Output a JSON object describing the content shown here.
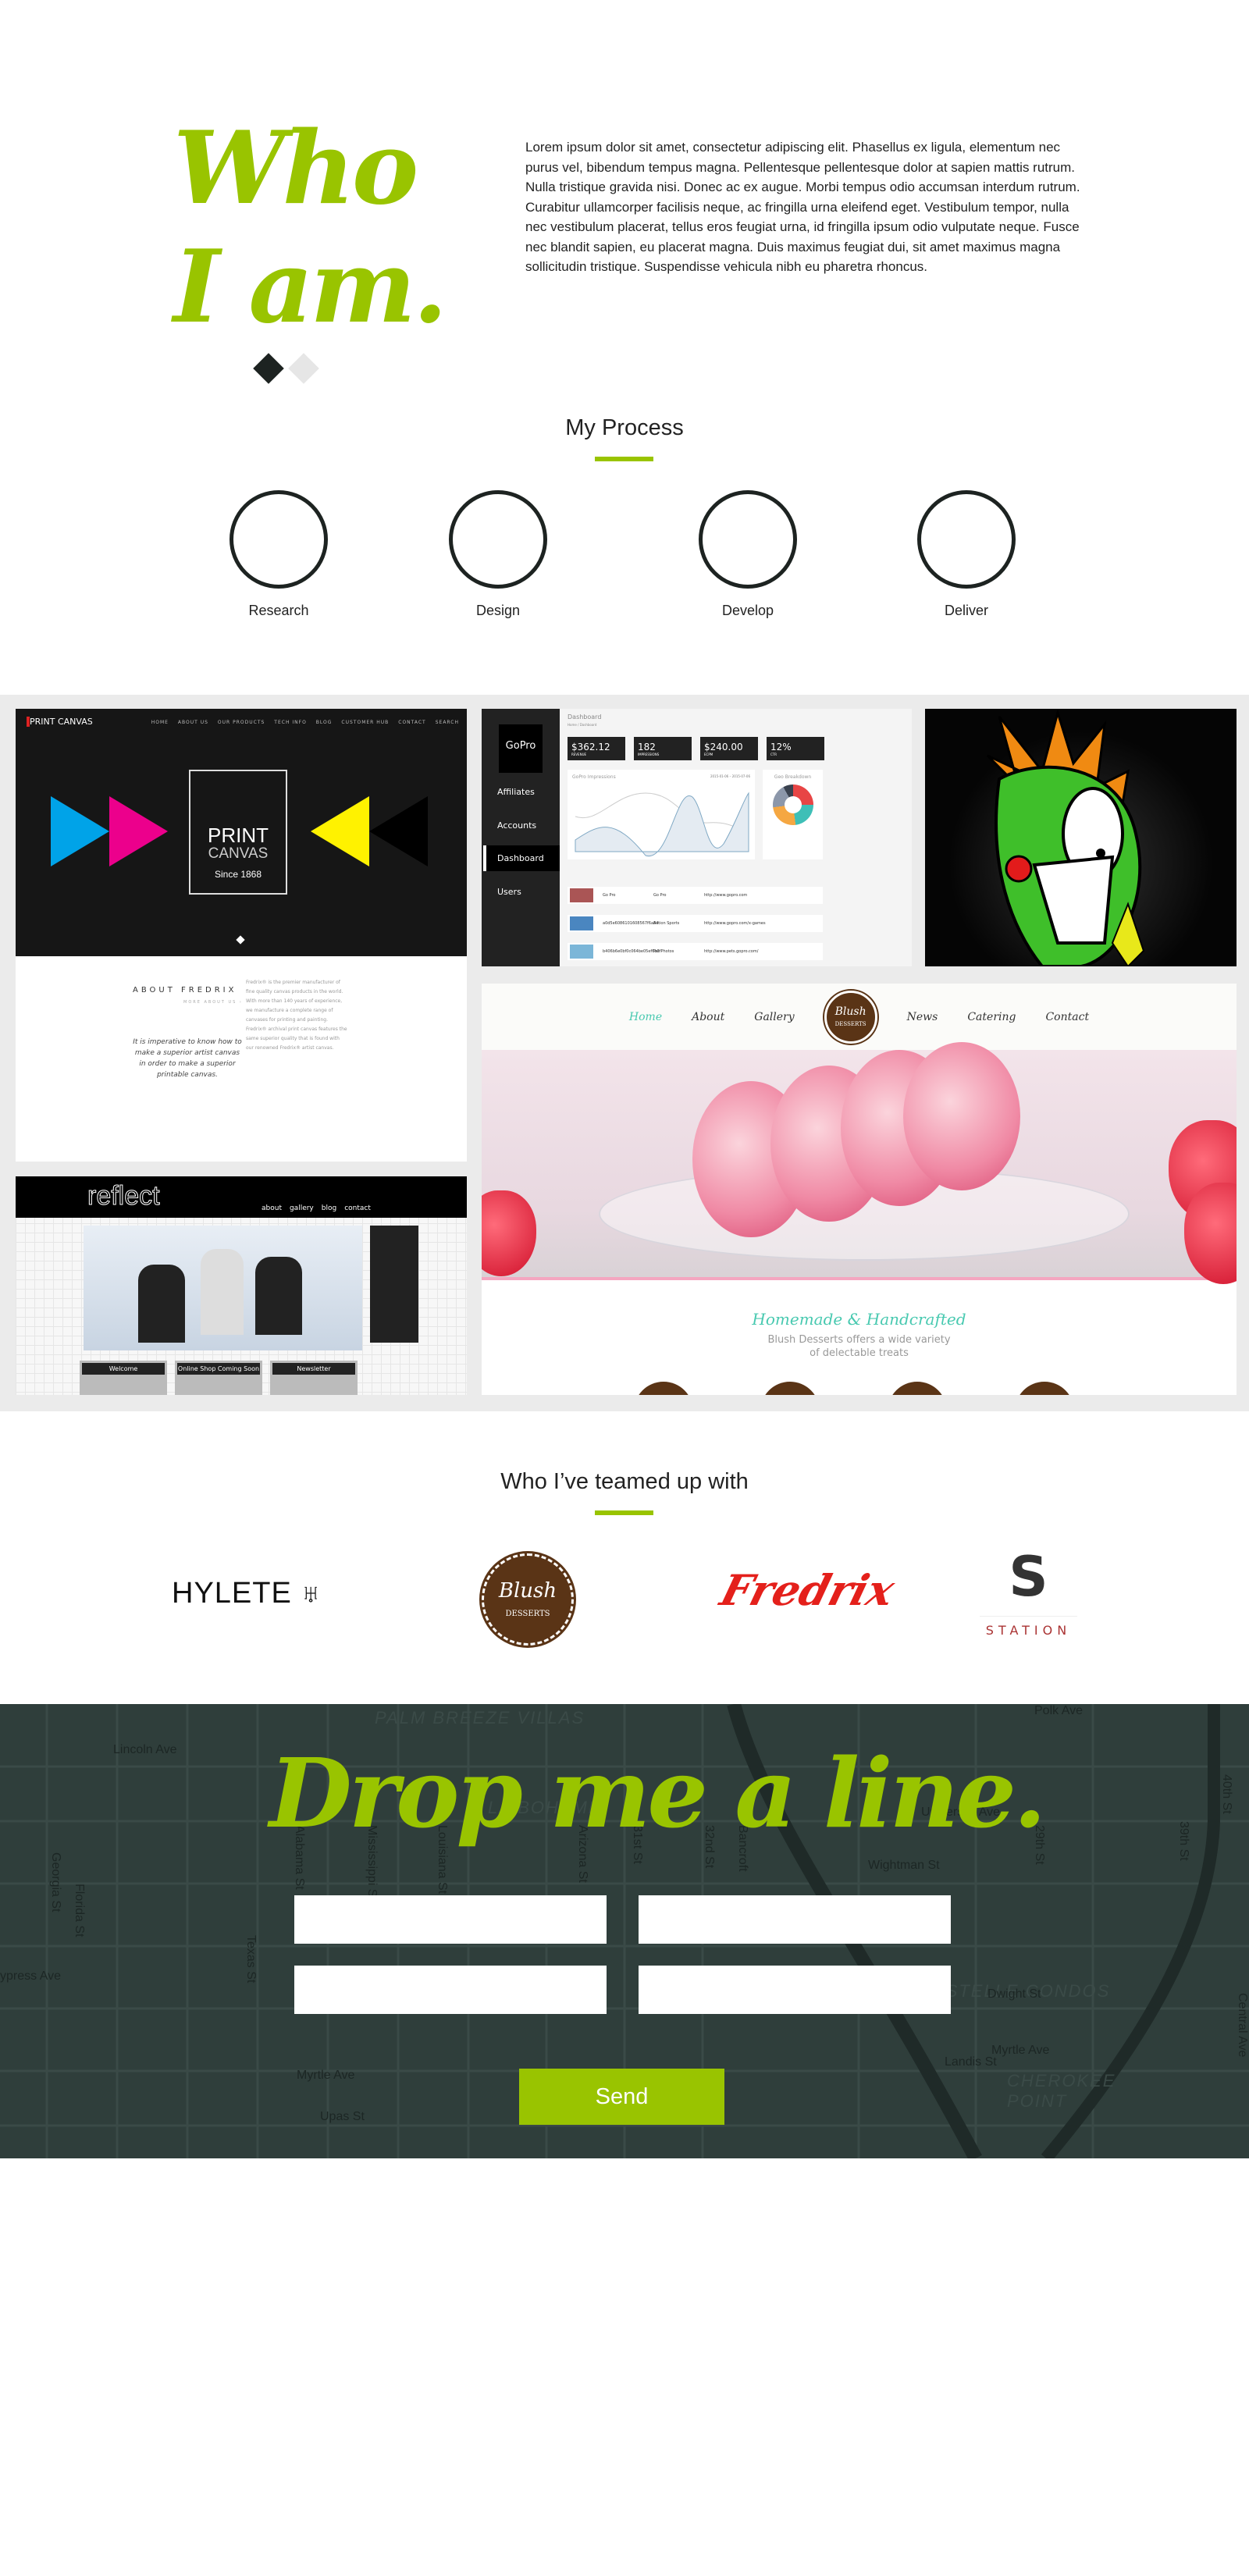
{
  "about": {
    "title_line1": "Who",
    "title_line2": "I am.",
    "paragraph": "Lorem ipsum dolor sit amet, consectetur adipiscing elit. Phasellus ex ligula, elementum nec purus vel, bibendum tempus magna. Pellentesque pellentesque dolor at sapien mattis rutrum. Nulla tristique gravida nisi. Donec ac ex augue. Morbi tempus odio accumsan interdum rutrum. Curabitur ullamcorper facilisis neque, ac fringilla urna eleifend eget. Vestibulum tempor, nulla nec vestibulum placerat, tellus eros feugiat urna, id fringilla ipsum odio vulputate neque. Fusce nec blandit sapien, eu placerat magna. Duis maximus feugiat dui, sit amet maximus magna sollicitudin tristique. Suspendisse vehicula nibh eu pharetra rhoncus.",
    "slider_active": 1,
    "slider_count": 2
  },
  "process": {
    "title": "My Process",
    "steps": [
      "Research",
      "Design",
      "Develop",
      "Deliver"
    ]
  },
  "portfolio": {
    "print_canvas": {
      "logo": "PRINT CANVAS",
      "nav": [
        "HOME",
        "ABOUT US",
        "OUR PRODUCTS",
        "TECH INFO",
        "BLOG",
        "CUSTOMER HUB",
        "CONTACT",
        "SEARCH"
      ],
      "box_line1": "PRINT",
      "box_line2": "CANVAS",
      "box_line3": "Since 1868",
      "about_heading": "ABOUT FREDRIX",
      "about_link": "MORE ABOUT US ›",
      "quote": "It is imperative to know how to make a superior artist canvas in order to make a superior printable canvas.",
      "body": "Fredrix® is the premier manufacturer of fine quality canvas products in the world. With more than 140 years of experience, we manufacture a complete range of canvases for printing and painting. Fredrix® archival print canvas features the same superior quality that is found with our renowned Fredrix® artist canvas."
    },
    "gopro": {
      "logo": "GoPro",
      "title": "Dashboard",
      "breadcrumb": "Home / Dashboard",
      "nav": [
        "Affiliates",
        "Accounts",
        "Dashboard",
        "Users"
      ],
      "active_nav": "Dashboard",
      "stats": [
        {
          "value": "$362.12",
          "label": "REVENUE"
        },
        {
          "value": "182",
          "label": "IMPRESSIONS"
        },
        {
          "value": "$240.00",
          "label": "ECPM"
        },
        {
          "value": "12%",
          "label": "CTR"
        }
      ],
      "chart_title": "GoPro Impressions",
      "from": "2015-01-06",
      "to": "2015-07-06",
      "geo_title": "Geo Breakdown",
      "rows": [
        {
          "id": "Go Pro",
          "name": "Go Pro",
          "url": "http://www.gopro.com"
        },
        {
          "id": "a0d5e6086101608567f6a84",
          "name": "Action Sports",
          "url": "http://www.gopro.com/x-games"
        },
        {
          "id": "b406b6e0bf0c064be05ef6b0f",
          "name": "Pet Photos",
          "url": "http://www.pets.gopro.com/"
        }
      ]
    },
    "blush": {
      "nav": [
        "Home",
        "About",
        "Gallery",
        "News",
        "Catering",
        "Contact"
      ],
      "badge": "Blush",
      "badge_sub": "DESSERTS",
      "tagline": "Homemade & Handcrafted",
      "sub1": "Blush Desserts offers a wide variety",
      "sub2": "of delectable treats"
    },
    "reflect": {
      "logo": "reflect",
      "nav": [
        "about",
        "gallery",
        "blog",
        "contact"
      ],
      "boxes": [
        "Welcome",
        "Online Shop Coming Soon",
        "Newsletter"
      ]
    }
  },
  "partners": {
    "title": "Who I’ve teamed up with",
    "logos": [
      "HYLETE",
      "Blush",
      "DESSERTS",
      "Fredrix",
      "STATION"
    ]
  },
  "contact": {
    "title": "Drop me a line.",
    "send_label": "Send",
    "map_labels": [
      "Lincoln Ave",
      "PALM BREEZE VILLAS",
      "LA BOHEME",
      "University Ave",
      "Florida St",
      "Georgia St",
      "Alabama St",
      "Mississippi St",
      "Louisiana St",
      "Texas St",
      "Arizona St",
      "29th St",
      "31st St",
      "32nd St",
      "Bancroft",
      "Wightman St",
      "ESTELLE CONDOS",
      "Landis St",
      "CHEROKEE POINT",
      "Dwight St",
      "Myrtle Ave",
      "Upas St",
      "ypress Ave",
      "Polk Ave",
      "40th St",
      "39th St",
      "Central Ave"
    ]
  },
  "colors": {
    "accent": "#99c400",
    "dark": "#1d2321",
    "map": "#2f3e3b",
    "gallery_bg": "#ebebeb"
  }
}
